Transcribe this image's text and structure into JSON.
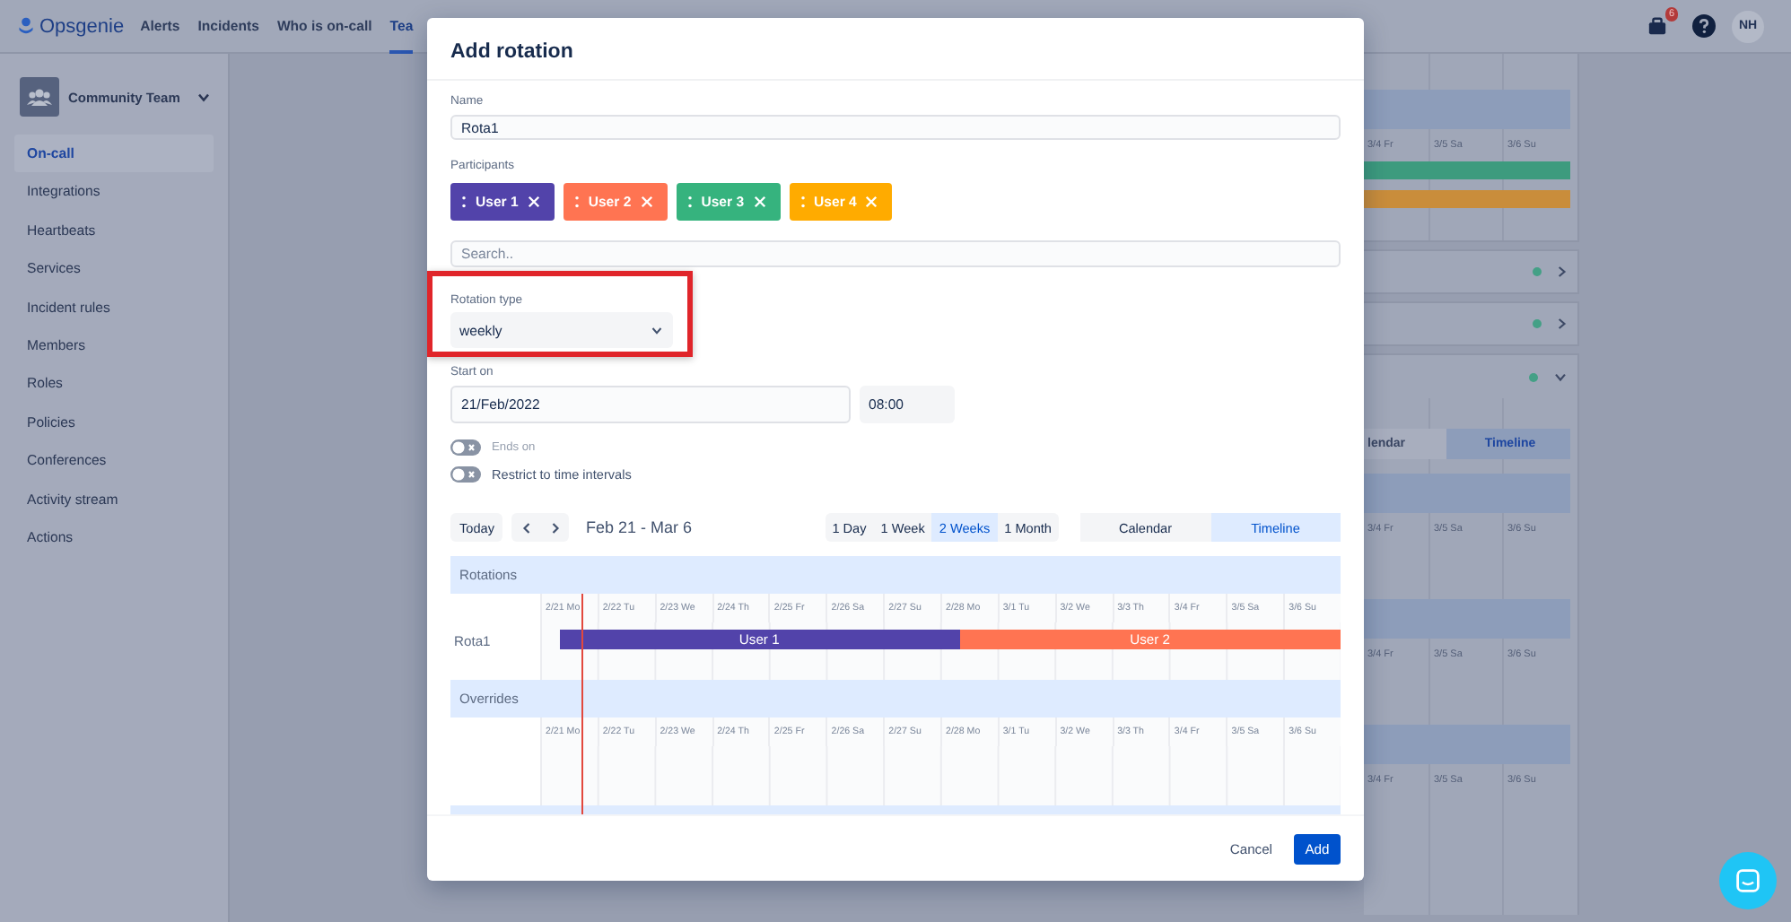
{
  "nav": {
    "logo": "Opsgenie",
    "tabs": [
      {
        "label": "Alerts",
        "selected": false
      },
      {
        "label": "Incidents",
        "selected": false
      },
      {
        "label": "Who is on-call",
        "selected": false
      },
      {
        "label": "Tea",
        "selected": true
      }
    ],
    "notification_count": "6",
    "avatar": "NH"
  },
  "sidebar": {
    "team": "Community Team",
    "items": [
      {
        "label": "On-call",
        "selected": true
      },
      {
        "label": "Integrations",
        "selected": false
      },
      {
        "label": "Heartbeats",
        "selected": false
      },
      {
        "label": "Services",
        "selected": false
      },
      {
        "label": "Incident rules",
        "selected": false
      },
      {
        "label": "Members",
        "selected": false
      },
      {
        "label": "Roles",
        "selected": false
      },
      {
        "label": "Policies",
        "selected": false
      },
      {
        "label": "Conferences",
        "selected": false
      },
      {
        "label": "Activity stream",
        "selected": false
      },
      {
        "label": "Actions",
        "selected": false
      }
    ]
  },
  "background_panel": {
    "timeline_card": {
      "days": [
        "3/4 Fr",
        "3/5 Sa",
        "3/6 Su"
      ],
      "bars": [
        {
          "color": "#3d9b7e"
        },
        {
          "color": "#c98d3b"
        }
      ]
    },
    "schedule_rows": [
      {
        "expanded": false
      },
      {
        "expanded": false
      },
      {
        "expanded": true
      }
    ],
    "view_toggle": [
      {
        "label": "lendar",
        "selected": false
      },
      {
        "label": "Timeline",
        "selected": true
      }
    ],
    "sections": [
      {
        "days": [
          "3/4 Fr",
          "3/5 Sa",
          "3/6 Su"
        ]
      },
      {
        "days": [
          "3/4 Fr",
          "3/5 Sa",
          "3/6 Su"
        ]
      },
      {
        "days": [
          "3/4 Fr",
          "3/5 Sa",
          "3/6 Su"
        ]
      }
    ]
  },
  "modal": {
    "title": "Add rotation",
    "name": {
      "label": "Name",
      "value": "Rota1"
    },
    "participants": {
      "label": "Participants",
      "chips": [
        {
          "label": "User 1",
          "color": "#5243aa"
        },
        {
          "label": "User 2",
          "color": "#ff7452"
        },
        {
          "label": "User 3",
          "color": "#36b37e"
        },
        {
          "label": "User 4",
          "color": "#ffab00"
        }
      ]
    },
    "search": {
      "placeholder": "Search.."
    },
    "rotation_type": {
      "label": "Rotation type",
      "value": "weekly",
      "highlighted": true
    },
    "start": {
      "label": "Start on",
      "date": "21/Feb/2022",
      "time": "08:00"
    },
    "toggles": [
      {
        "label": "Ends on",
        "on": false,
        "disabled": true
      },
      {
        "label": "Restrict to time intervals",
        "on": false,
        "disabled": false
      }
    ],
    "toolbar": {
      "today": "Today",
      "range": "Feb 21 - Mar 6",
      "spans": [
        {
          "label": "1 Day",
          "selected": false
        },
        {
          "label": "1 Week",
          "selected": false
        },
        {
          "label": "2 Weeks",
          "selected": true
        },
        {
          "label": "1 Month",
          "selected": false
        }
      ],
      "views": [
        {
          "label": "Calendar",
          "selected": false
        },
        {
          "label": "Timeline",
          "selected": true
        }
      ]
    },
    "timeline": {
      "sections": [
        {
          "title": "Rotations",
          "days": [
            "2/21 Mo",
            "2/22 Tu",
            "2/23 We",
            "2/24 Th",
            "2/25 Fr",
            "2/26 Sa",
            "2/27 Su",
            "2/28 Mo",
            "3/1 Tu",
            "3/2 We",
            "3/3 Th",
            "3/4 Fr",
            "3/5 Sa",
            "3/6 Su"
          ],
          "rows": [
            {
              "label": "Rota1",
              "segments": [
                {
                  "label": "User 1",
                  "color": "#5243aa"
                },
                {
                  "label": "User 2",
                  "color": "#ff7452"
                }
              ]
            }
          ]
        },
        {
          "title": "Overrides",
          "days": [
            "2/21 Mo",
            "2/22 Tu",
            "2/23 We",
            "2/24 Th",
            "2/25 Fr",
            "2/26 Sa",
            "2/27 Su",
            "2/28 Mo",
            "3/1 Tu",
            "3/2 We",
            "3/3 Th",
            "3/4 Fr",
            "3/5 Sa",
            "3/6 Su"
          ]
        }
      ]
    },
    "buttons": {
      "cancel": "Cancel",
      "add": "Add"
    }
  }
}
